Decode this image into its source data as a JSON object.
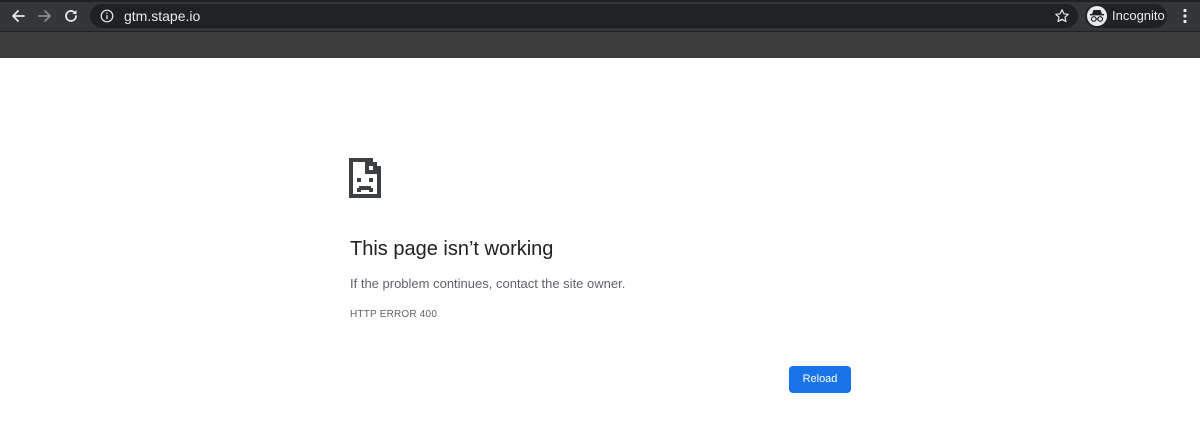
{
  "browser": {
    "url": "gtm.stape.io",
    "profile_label": "Incognito",
    "icons": {
      "back": "back-arrow-icon",
      "forward": "forward-arrow-icon",
      "reload": "reload-icon",
      "site_info": "info-icon",
      "bookmark": "star-icon",
      "profile": "incognito-icon",
      "menu": "kebab-menu-icon"
    }
  },
  "error_page": {
    "icon": "sad-document-icon",
    "title": "This page isn’t working",
    "description": "If the problem continues, contact the site owner.",
    "error_code": "HTTP ERROR 400",
    "reload_label": "Reload"
  },
  "colors": {
    "toolbar": "#35363a",
    "omnibox": "#202124",
    "bookmark_bar": "#3c3c3c",
    "accent": "#1a73e8"
  }
}
